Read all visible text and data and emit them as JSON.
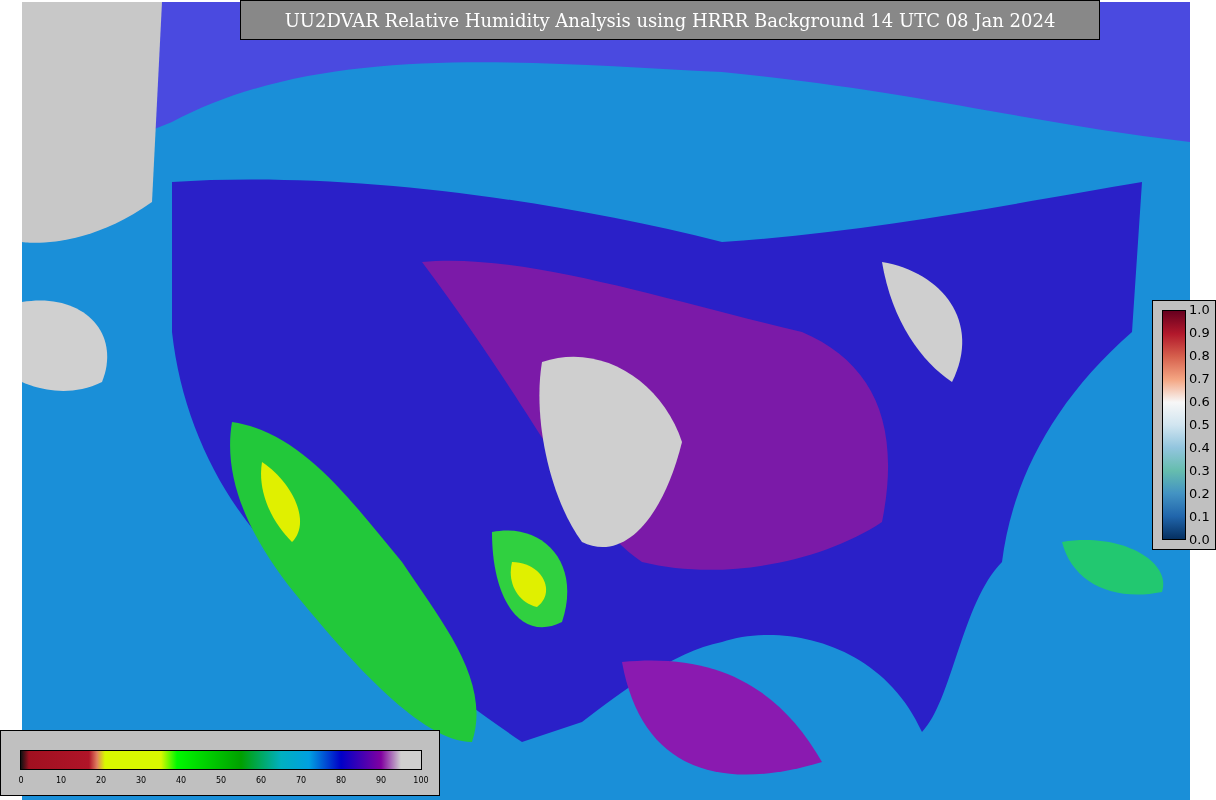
{
  "title": "UU2DVAR Relative Humidity Analysis using HRRR Background 14 UTC 08 Jan 2024",
  "ob_colorbar": {
    "ticks": [
      "1.0",
      "0.9",
      "0.8",
      "0.7",
      "0.6",
      "0.5",
      "0.4",
      "0.3",
      "0.2",
      "0.1",
      "0.0"
    ]
  },
  "humidity_colorbar": {
    "ticks": [
      "0",
      "10",
      "20",
      "30",
      "40",
      "50",
      "60",
      "70",
      "80",
      "90",
      "100"
    ]
  }
}
